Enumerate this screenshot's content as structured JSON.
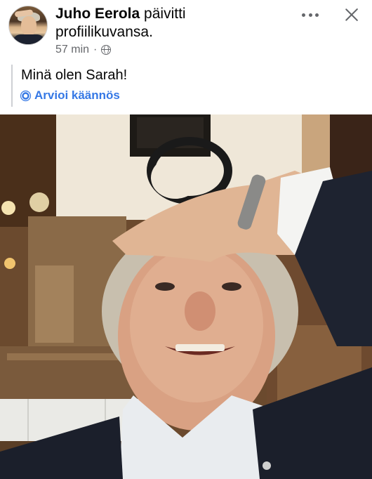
{
  "post": {
    "author": "Juho Eerola",
    "action": "päivitti profiilikuvansa.",
    "time": "57 min",
    "separator": "·",
    "audience_icon": "globe-icon",
    "text": "Minä olen Sarah!",
    "translate_label": "Arvioi käännös"
  },
  "colors": {
    "link_blue": "#3578e5",
    "secondary_text": "#65676b"
  }
}
